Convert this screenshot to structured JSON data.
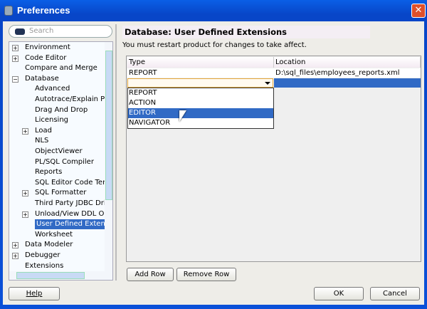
{
  "window": {
    "title": "Preferences"
  },
  "search": {
    "placeholder": "Search"
  },
  "tree": [
    {
      "label": "Environment",
      "level": 0,
      "expander": "+"
    },
    {
      "label": "Code Editor",
      "level": 0,
      "expander": "+"
    },
    {
      "label": "Compare and Merge",
      "level": 0,
      "expander": ""
    },
    {
      "label": "Database",
      "level": 0,
      "expander": "-"
    },
    {
      "label": "Advanced",
      "level": 1,
      "expander": ""
    },
    {
      "label": "Autotrace/Explain Plan",
      "level": 1,
      "expander": ""
    },
    {
      "label": "Drag And Drop",
      "level": 1,
      "expander": ""
    },
    {
      "label": "Licensing",
      "level": 1,
      "expander": ""
    },
    {
      "label": "Load",
      "level": 1,
      "expander": "+"
    },
    {
      "label": "NLS",
      "level": 1,
      "expander": ""
    },
    {
      "label": "ObjectViewer",
      "level": 1,
      "expander": ""
    },
    {
      "label": "PL/SQL Compiler",
      "level": 1,
      "expander": ""
    },
    {
      "label": "Reports",
      "level": 1,
      "expander": ""
    },
    {
      "label": "SQL Editor Code Templates",
      "level": 1,
      "expander": ""
    },
    {
      "label": "SQL Formatter",
      "level": 1,
      "expander": "+"
    },
    {
      "label": "Third Party JDBC Drivers",
      "level": 1,
      "expander": ""
    },
    {
      "label": "Unload/View DDL Options",
      "level": 1,
      "expander": "+"
    },
    {
      "label": "User Defined Extensions",
      "level": 1,
      "expander": "",
      "selected": true
    },
    {
      "label": "Worksheet",
      "level": 1,
      "expander": ""
    },
    {
      "label": "Data Modeler",
      "level": 0,
      "expander": "+"
    },
    {
      "label": "Debugger",
      "level": 0,
      "expander": "+"
    },
    {
      "label": "Extensions",
      "level": 0,
      "expander": ""
    }
  ],
  "panel": {
    "heading": "Database: User Defined Extensions",
    "note": "You must restart product for changes to take affect.",
    "columns": [
      "Type",
      "Location"
    ],
    "rows": [
      {
        "type": "REPORT",
        "location": "D:\\sql_files\\employees_reports.xml"
      }
    ],
    "dropdown_options": [
      "REPORT",
      "ACTION",
      "EDITOR",
      "NAVIGATOR"
    ],
    "highlighted_option": "EDITOR",
    "add_row": "Add Row",
    "remove_row": "Remove Row"
  },
  "buttons": {
    "help": "Help",
    "ok": "OK",
    "cancel": "Cancel"
  }
}
